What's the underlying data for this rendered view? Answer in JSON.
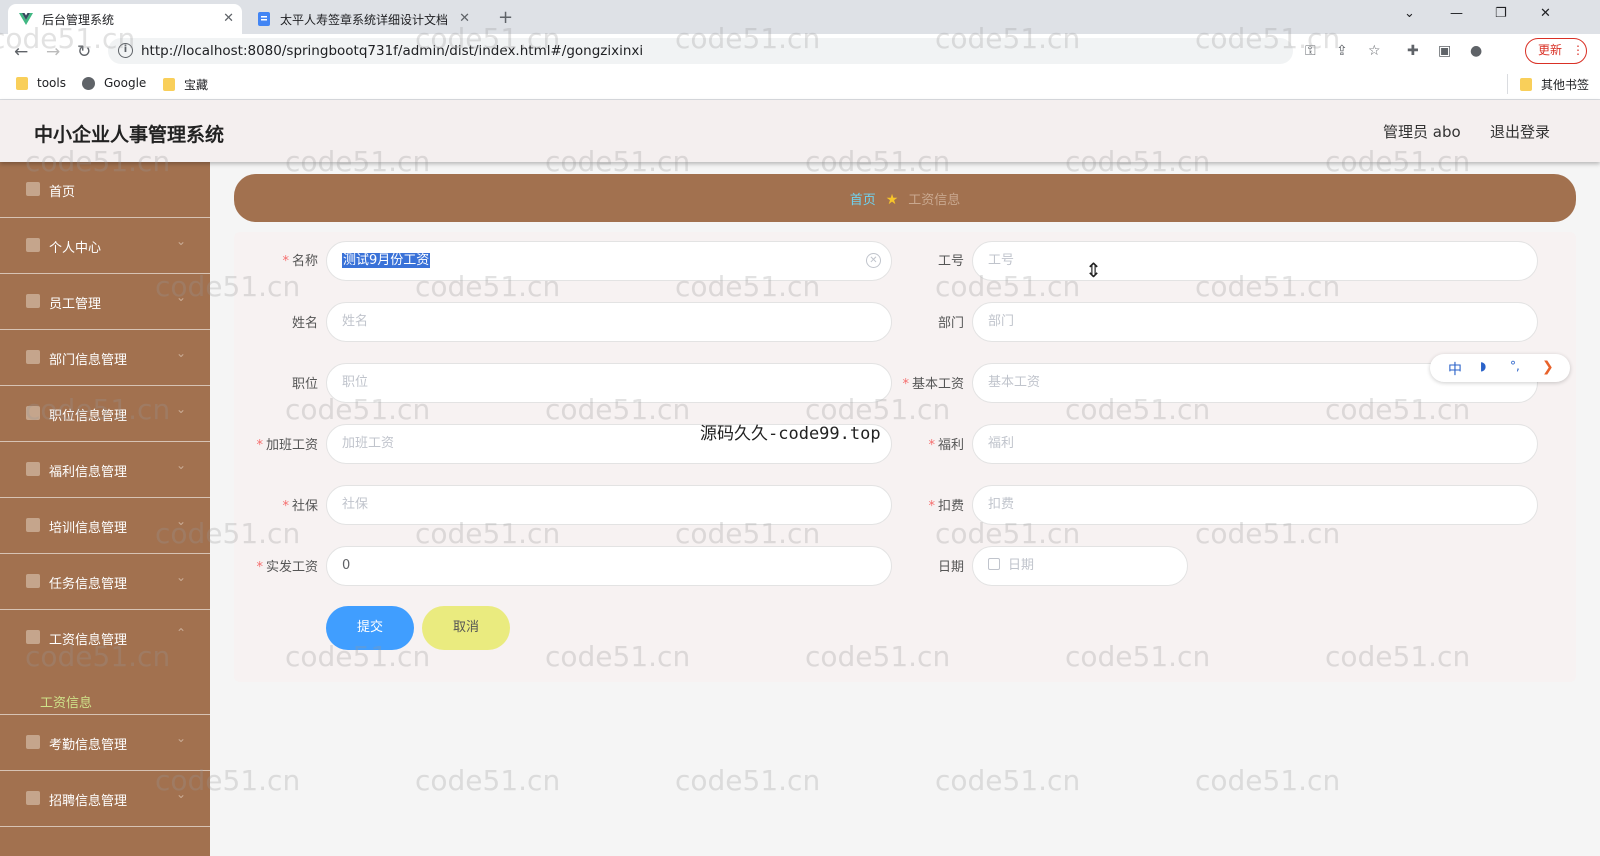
{
  "browser": {
    "tabs": [
      {
        "title": "后台管理系统",
        "active": true
      },
      {
        "title": "太平人寿签章系统详细设计文档",
        "active": false
      }
    ],
    "url": "http://localhost:8080/springbootq731f/admin/dist/index.html#/gongzixinxi",
    "update_label": "更新",
    "bookmarks": [
      "tools",
      "Google",
      "宝藏"
    ],
    "other_bookmarks": "其他书签"
  },
  "header": {
    "title": "中小企业人事管理系统",
    "user": "管理员 abo",
    "logout": "退出登录"
  },
  "sidebar": {
    "items": [
      {
        "label": "首页"
      },
      {
        "label": "个人中心"
      },
      {
        "label": "员工管理"
      },
      {
        "label": "部门信息管理"
      },
      {
        "label": "职位信息管理"
      },
      {
        "label": "福利信息管理"
      },
      {
        "label": "培训信息管理"
      },
      {
        "label": "任务信息管理"
      },
      {
        "label": "工资信息管理"
      },
      {
        "label": "考勤信息管理"
      },
      {
        "label": "招聘信息管理"
      }
    ],
    "active_sub": "工资信息"
  },
  "breadcrumb": {
    "home": "首页",
    "current": "工资信息"
  },
  "form": {
    "name": {
      "label": "名称",
      "value": "测试9月份工资",
      "required": true
    },
    "gonghao": {
      "label": "工号",
      "placeholder": "工号"
    },
    "xingming": {
      "label": "姓名",
      "placeholder": "姓名"
    },
    "bumen": {
      "label": "部门",
      "placeholder": "部门"
    },
    "zhiwei": {
      "label": "职位",
      "placeholder": "职位"
    },
    "jiben": {
      "label": "基本工资",
      "placeholder": "基本工资",
      "required": true
    },
    "jiaban": {
      "label": "加班工资",
      "placeholder": "加班工资",
      "required": true
    },
    "fuli": {
      "label": "福利",
      "placeholder": "福利",
      "required": true
    },
    "shebao": {
      "label": "社保",
      "placeholder": "社保",
      "required": true
    },
    "koufei": {
      "label": "扣费",
      "placeholder": "扣费",
      "required": true
    },
    "shifa": {
      "label": "实发工资",
      "value": "0",
      "required": true
    },
    "riqi": {
      "label": "日期",
      "placeholder": "日期"
    },
    "submit": "提交",
    "cancel": "取消"
  },
  "overlay_text": "源码久久-code99.top",
  "watermark": "code51.cn",
  "ime": [
    "中",
    "◗",
    "°,",
    "❯"
  ],
  "colors": {
    "sidebar": "#a2714f",
    "submit": "#409eff",
    "cancel": "#eaeb7f",
    "breadcrumb_home": "#6fd3f0"
  }
}
